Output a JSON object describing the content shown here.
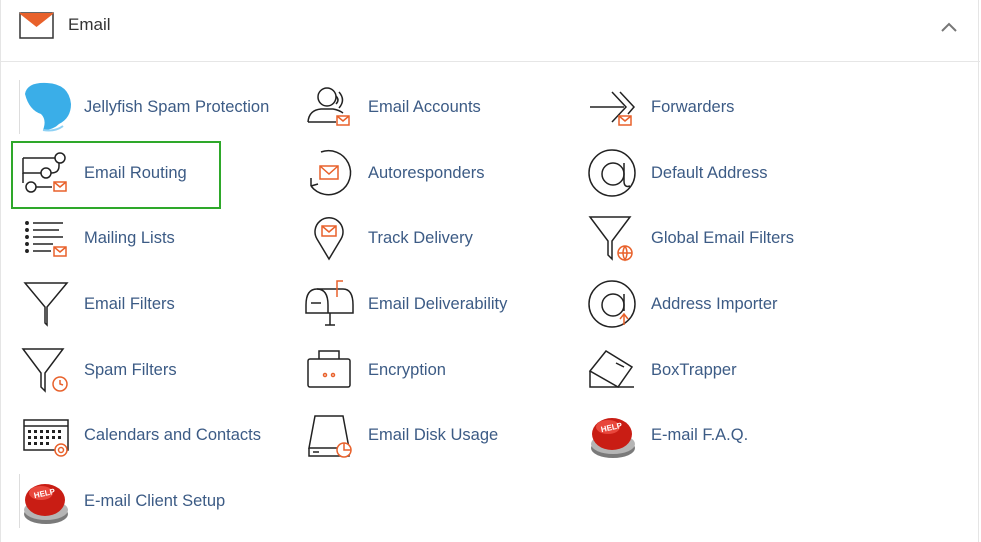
{
  "header": {
    "title": "Email",
    "icon": "envelope-icon",
    "accent": "#e8612b"
  },
  "items": [
    {
      "label": "Jellyfish Spam Protection",
      "icon": "jellyfish-icon"
    },
    {
      "label": "Email Accounts",
      "icon": "user-mail-icon"
    },
    {
      "label": "Forwarders",
      "icon": "forward-arrows-icon"
    },
    {
      "label": "Email Routing",
      "icon": "routing-icon"
    },
    {
      "label": "Autoresponders",
      "icon": "autoresponder-icon"
    },
    {
      "label": "Default Address",
      "icon": "at-sign-icon"
    },
    {
      "label": "Mailing Lists",
      "icon": "list-mail-icon"
    },
    {
      "label": "Track Delivery",
      "icon": "location-pin-mail-icon"
    },
    {
      "label": "Global Email Filters",
      "icon": "filter-globe-icon"
    },
    {
      "label": "Email Filters",
      "icon": "filter-icon"
    },
    {
      "label": "Email Deliverability",
      "icon": "mailbox-icon"
    },
    {
      "label": "Address Importer",
      "icon": "at-upload-icon"
    },
    {
      "label": "Spam Filters",
      "icon": "filter-clock-icon"
    },
    {
      "label": "Encryption",
      "icon": "briefcase-lock-icon"
    },
    {
      "label": "BoxTrapper",
      "icon": "box-trap-icon"
    },
    {
      "label": "Calendars and Contacts",
      "icon": "calendar-at-icon"
    },
    {
      "label": "Email Disk Usage",
      "icon": "disk-pie-icon"
    },
    {
      "label": "E-mail F.A.Q.",
      "icon": "help-button-icon"
    },
    {
      "label": "E-mail Client Setup",
      "icon": "help-button-icon"
    }
  ],
  "selected": "Email Routing",
  "colors": {
    "link": "#3c5b85",
    "highlight": "#2ea82a",
    "accent": "#e8612b"
  }
}
